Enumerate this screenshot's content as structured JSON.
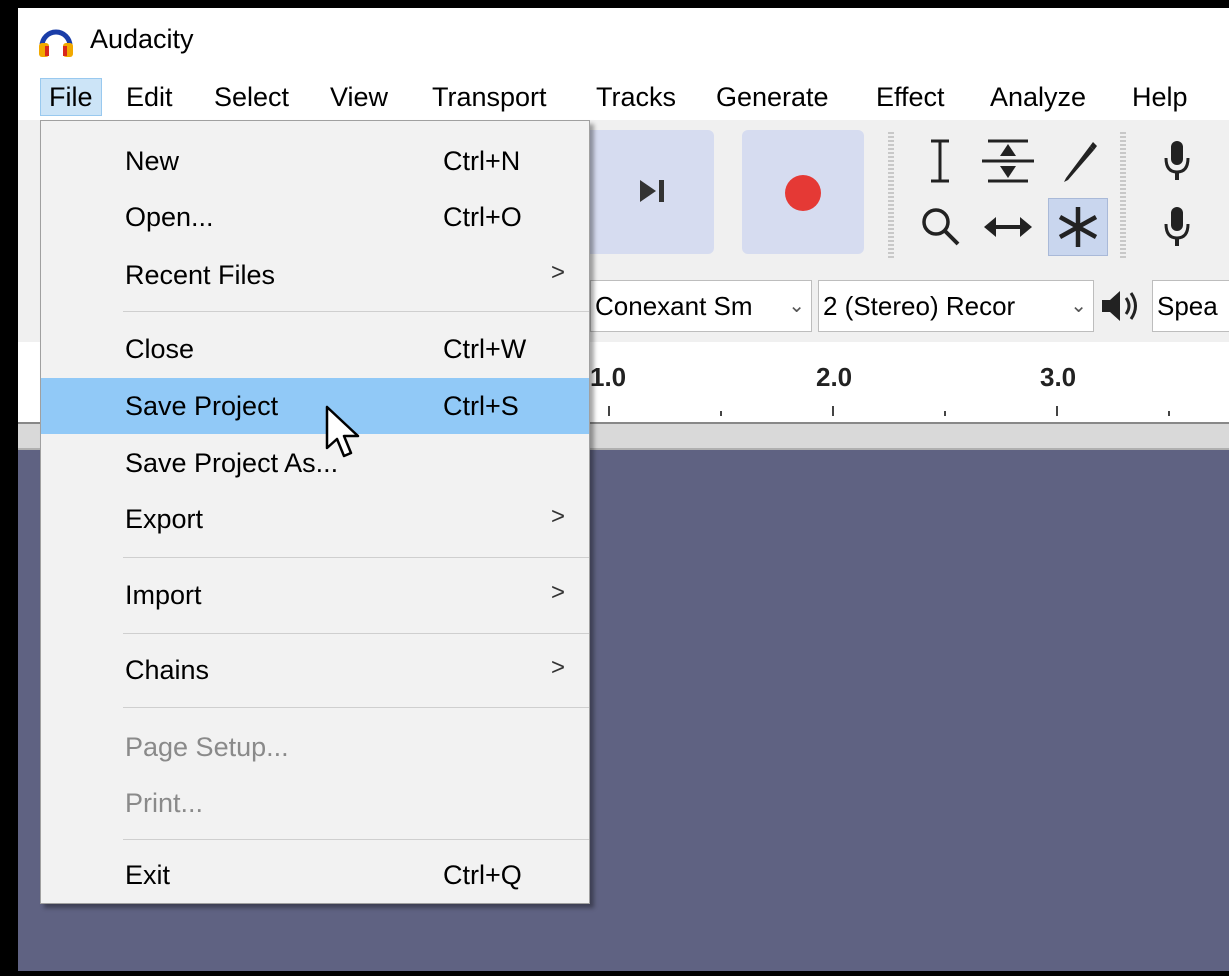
{
  "window": {
    "title": "Audacity"
  },
  "menubar": {
    "items": [
      "File",
      "Edit",
      "Select",
      "View",
      "Transport",
      "Tracks",
      "Generate",
      "Effect",
      "Analyze",
      "Help"
    ]
  },
  "devices": {
    "recording_device": "Conexant Sm",
    "channels": "2 (Stereo) Recor",
    "playback_device": "Spea"
  },
  "ruler": {
    "labels": [
      "1.0",
      "2.0",
      "3.0"
    ]
  },
  "file_menu": {
    "items": [
      {
        "label": "New",
        "shortcut": "Ctrl+N",
        "submenu": false,
        "disabled": false
      },
      {
        "label": "Open...",
        "shortcut": "Ctrl+O",
        "submenu": false,
        "disabled": false
      },
      {
        "label": "Recent Files",
        "shortcut": "",
        "submenu": true,
        "disabled": false
      },
      {
        "label": "Close",
        "shortcut": "Ctrl+W",
        "submenu": false,
        "disabled": false
      },
      {
        "label": "Save Project",
        "shortcut": "Ctrl+S",
        "submenu": false,
        "disabled": false,
        "highlighted": true
      },
      {
        "label": "Save Project As...",
        "shortcut": "",
        "submenu": false,
        "disabled": false
      },
      {
        "label": "Export",
        "shortcut": "",
        "submenu": true,
        "disabled": false
      },
      {
        "label": "Import",
        "shortcut": "",
        "submenu": true,
        "disabled": false
      },
      {
        "label": "Chains",
        "shortcut": "",
        "submenu": true,
        "disabled": false
      },
      {
        "label": "Page Setup...",
        "shortcut": "",
        "submenu": false,
        "disabled": true
      },
      {
        "label": "Print...",
        "shortcut": "",
        "submenu": false,
        "disabled": true
      },
      {
        "label": "Exit",
        "shortcut": "Ctrl+Q",
        "submenu": false,
        "disabled": false
      }
    ],
    "submenu_glyph": ">"
  },
  "colors": {
    "highlight": "#91c9f7",
    "record_red": "#e53935",
    "track_area": "#5f6282",
    "button_bg": "#d6dcf0"
  },
  "icons": {
    "app": "audacity-headphones-icon",
    "skip_end": "skip-to-end-icon",
    "record": "record-icon",
    "tools": [
      "selection-tool-icon",
      "envelope-tool-icon",
      "draw-tool-icon",
      "zoom-tool-icon",
      "time-shift-tool-icon",
      "multi-tool-icon"
    ],
    "mic": "microphone-icon",
    "speaker": "speaker-icon",
    "cursor": "mouse-pointer-icon"
  }
}
